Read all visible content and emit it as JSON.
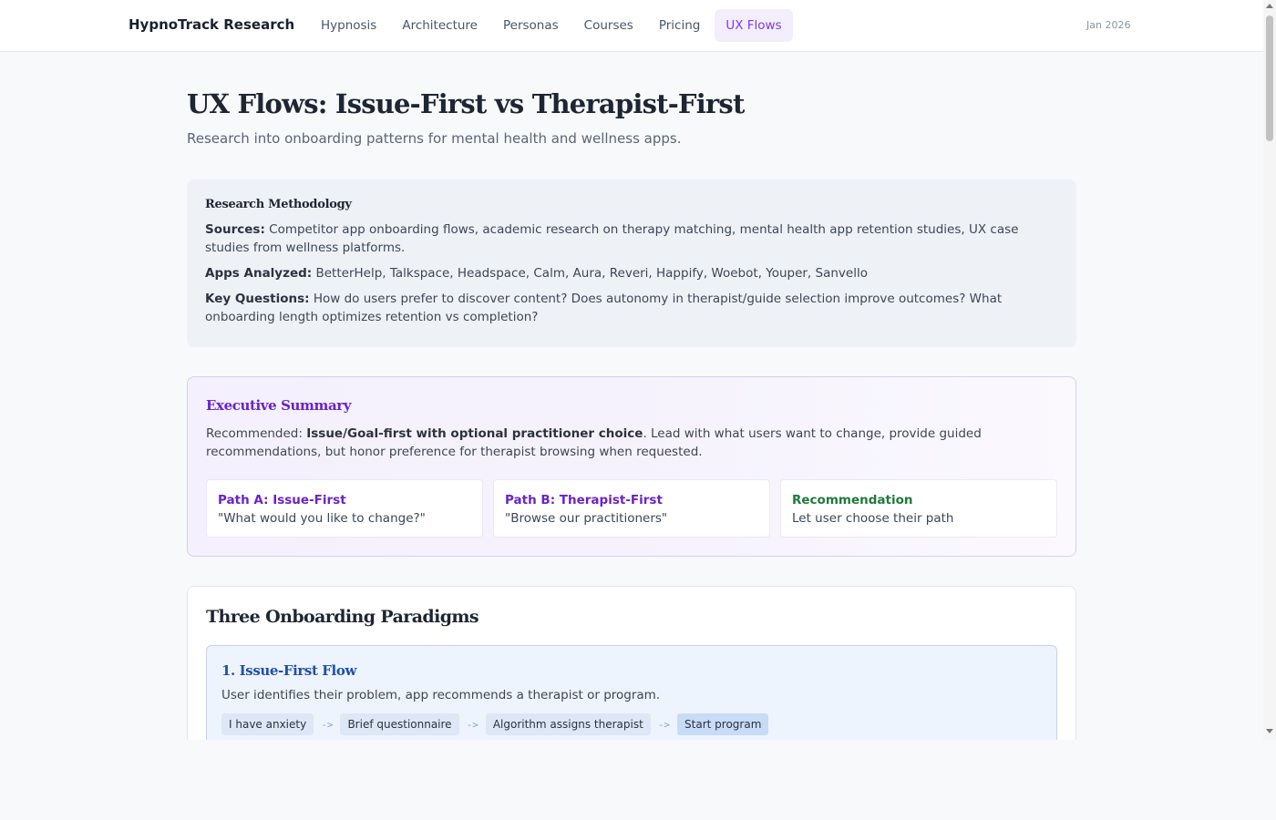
{
  "header": {
    "brand": "HypnoTrack Research",
    "nav": [
      "Hypnosis",
      "Architecture",
      "Personas",
      "Courses",
      "Pricing",
      "UX Flows"
    ],
    "active_nav": "UX Flows",
    "date": "Jan 2026"
  },
  "page": {
    "title": "UX Flows: Issue-First vs Therapist-First",
    "subtitle": "Research into onboarding patterns for mental health and wellness apps."
  },
  "methodology": {
    "heading": "Research Methodology",
    "sources_label": "Sources:",
    "sources_text": " Competitor app onboarding flows, academic research on therapy matching, mental health app retention studies, UX case studies from wellness platforms.",
    "apps_label": "Apps Analyzed:",
    "apps_text": " BetterHelp, Talkspace, Headspace, Calm, Aura, Reveri, Happify, Woebot, Youper, Sanvello",
    "questions_label": "Key Questions:",
    "questions_text": " How do users prefer to discover content? Does autonomy in therapist/guide selection improve outcomes? What onboarding length optimizes retention vs completion?"
  },
  "executive_summary": {
    "heading": "Executive Summary",
    "intro": "Recommended: ",
    "bold": "Issue/Goal-first with optional practitioner choice",
    "rest": ". Lead with what users want to change, provide guided recommendations, but honor preference for therapist browsing when requested.",
    "paths": [
      {
        "title": "Path A: Issue-First",
        "desc": "\"What would you like to change?\""
      },
      {
        "title": "Path B: Therapist-First",
        "desc": "\"Browse our practitioners\""
      },
      {
        "title": "Recommendation",
        "desc": "Let user choose their path"
      }
    ]
  },
  "paradigms": {
    "heading": "Three Onboarding Paradigms",
    "flows": [
      {
        "title": "1. Issue-First Flow",
        "desc": "User identifies their problem, app recommends a therapist or program.",
        "steps": [
          "I have anxiety",
          "Brief questionnaire",
          "Algorithm assigns therapist",
          "Start program"
        ],
        "arrow": "->"
      }
    ]
  },
  "colors": {
    "accent": "#7c3aed",
    "exec_heading": "#6a22c9",
    "recommendation": "#1f7a3b",
    "flow_heading": "#1f4fa8"
  }
}
